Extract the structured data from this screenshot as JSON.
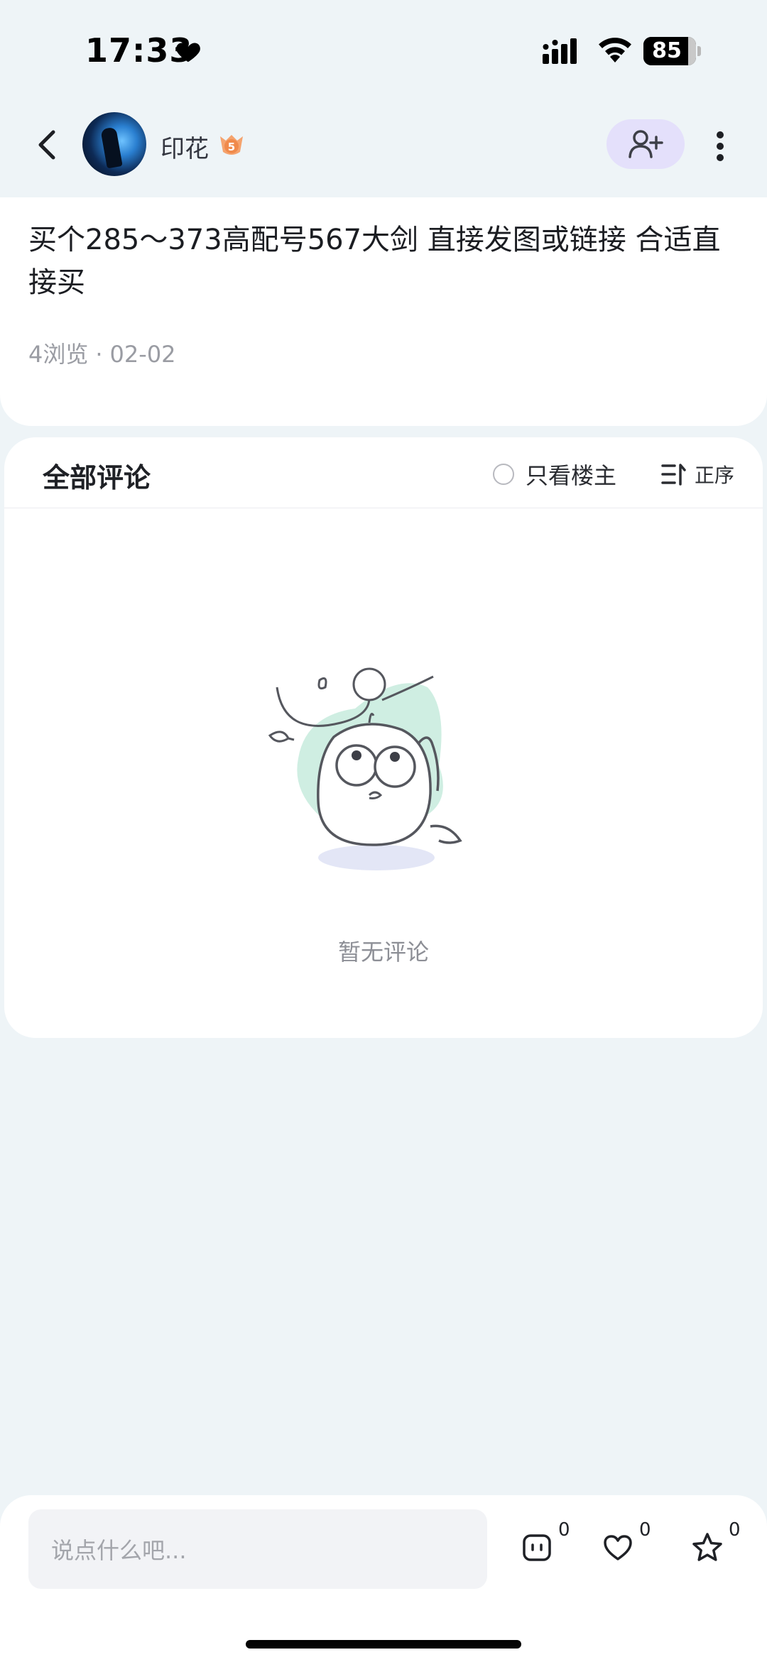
{
  "status_bar": {
    "time": "17:33",
    "battery": "85",
    "battery_level_percent": 85
  },
  "header": {
    "username": "印花",
    "level": "5",
    "icons": [
      "back-icon",
      "avatar",
      "level-badge-icon",
      "add-friend-icon",
      "more-vertical-icon"
    ]
  },
  "post": {
    "title": "买个285～373高配号567大剑 直接发图或链接 合适直接买",
    "views": "4浏览",
    "separator": "·",
    "date": "02-02"
  },
  "comments": {
    "title": "全部评论",
    "only_op_label": "只看楼主",
    "sort_label": "正序",
    "empty_text": "暂无评论"
  },
  "bottom_bar": {
    "input_placeholder": "说点什么吧...",
    "comment_count": "0",
    "like_count": "0",
    "favorite_count": "0"
  },
  "colors": {
    "background": "#eef4f7",
    "follow_button_bg": "#e4e0fb",
    "illustration_accent": "#cfeee2",
    "badge_orange": "#f08a4b"
  }
}
